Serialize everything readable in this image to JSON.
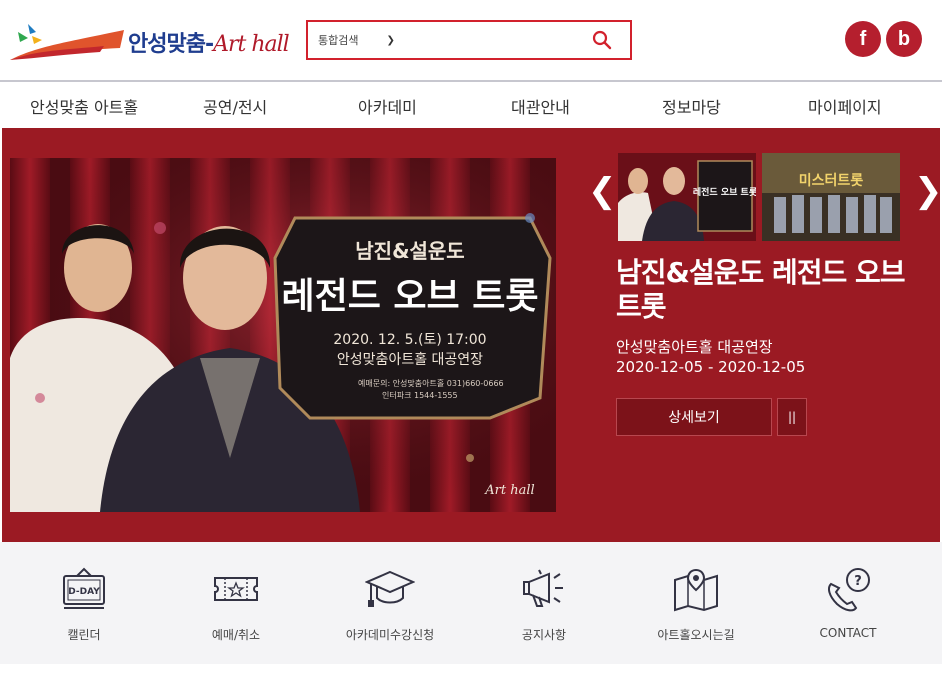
{
  "logo": {
    "text": "안성맞춤-",
    "art": "Art hall"
  },
  "search": {
    "category": "통합검색",
    "placeholder": ""
  },
  "social": {
    "facebook": "f",
    "blog": "b"
  },
  "nav": [
    "안성맞춤 아트홀",
    "공연/전시",
    "아카데미",
    "대관안내",
    "정보마당",
    "마이페이지"
  ],
  "banner": {
    "subtitle": "남진&설운도",
    "title": "레전드 오브 트롯",
    "datetime": "2020. 12. 5.(토) 17:00",
    "place": "안성맞춤아트홀 대공연장",
    "inquiry": "예매문의: 안성맞춤아트홀 031)660-0666",
    "ticket": "인터파크 1544-1555",
    "brand": "Art hall"
  },
  "thumbs": [
    {
      "name": "legend-of-trot",
      "label": "레전드 오브 트롯"
    },
    {
      "name": "mister-trot",
      "label": "미스터트롯"
    }
  ],
  "hero": {
    "title": "남진&설운도 레전드 오브 트롯",
    "venue": "안성맞춤아트홀 대공연장",
    "date": "2020-12-05 - 2020-12-05",
    "detail_label": "상세보기",
    "pause_label": "||",
    "prev": "❮",
    "next": "❯"
  },
  "quick_links": [
    "캘린더",
    "예매/취소",
    "아카데미수강신청",
    "공지사항",
    "아트홀오시는길",
    "CONTACT"
  ],
  "calendar_icon_text": "D-DAY",
  "colors": {
    "brand_red": "#9b1a23",
    "button_red": "#7c1219",
    "search_border": "#d2212d",
    "social": "#b51f2e",
    "logo_blue": "#1f3d8f"
  }
}
